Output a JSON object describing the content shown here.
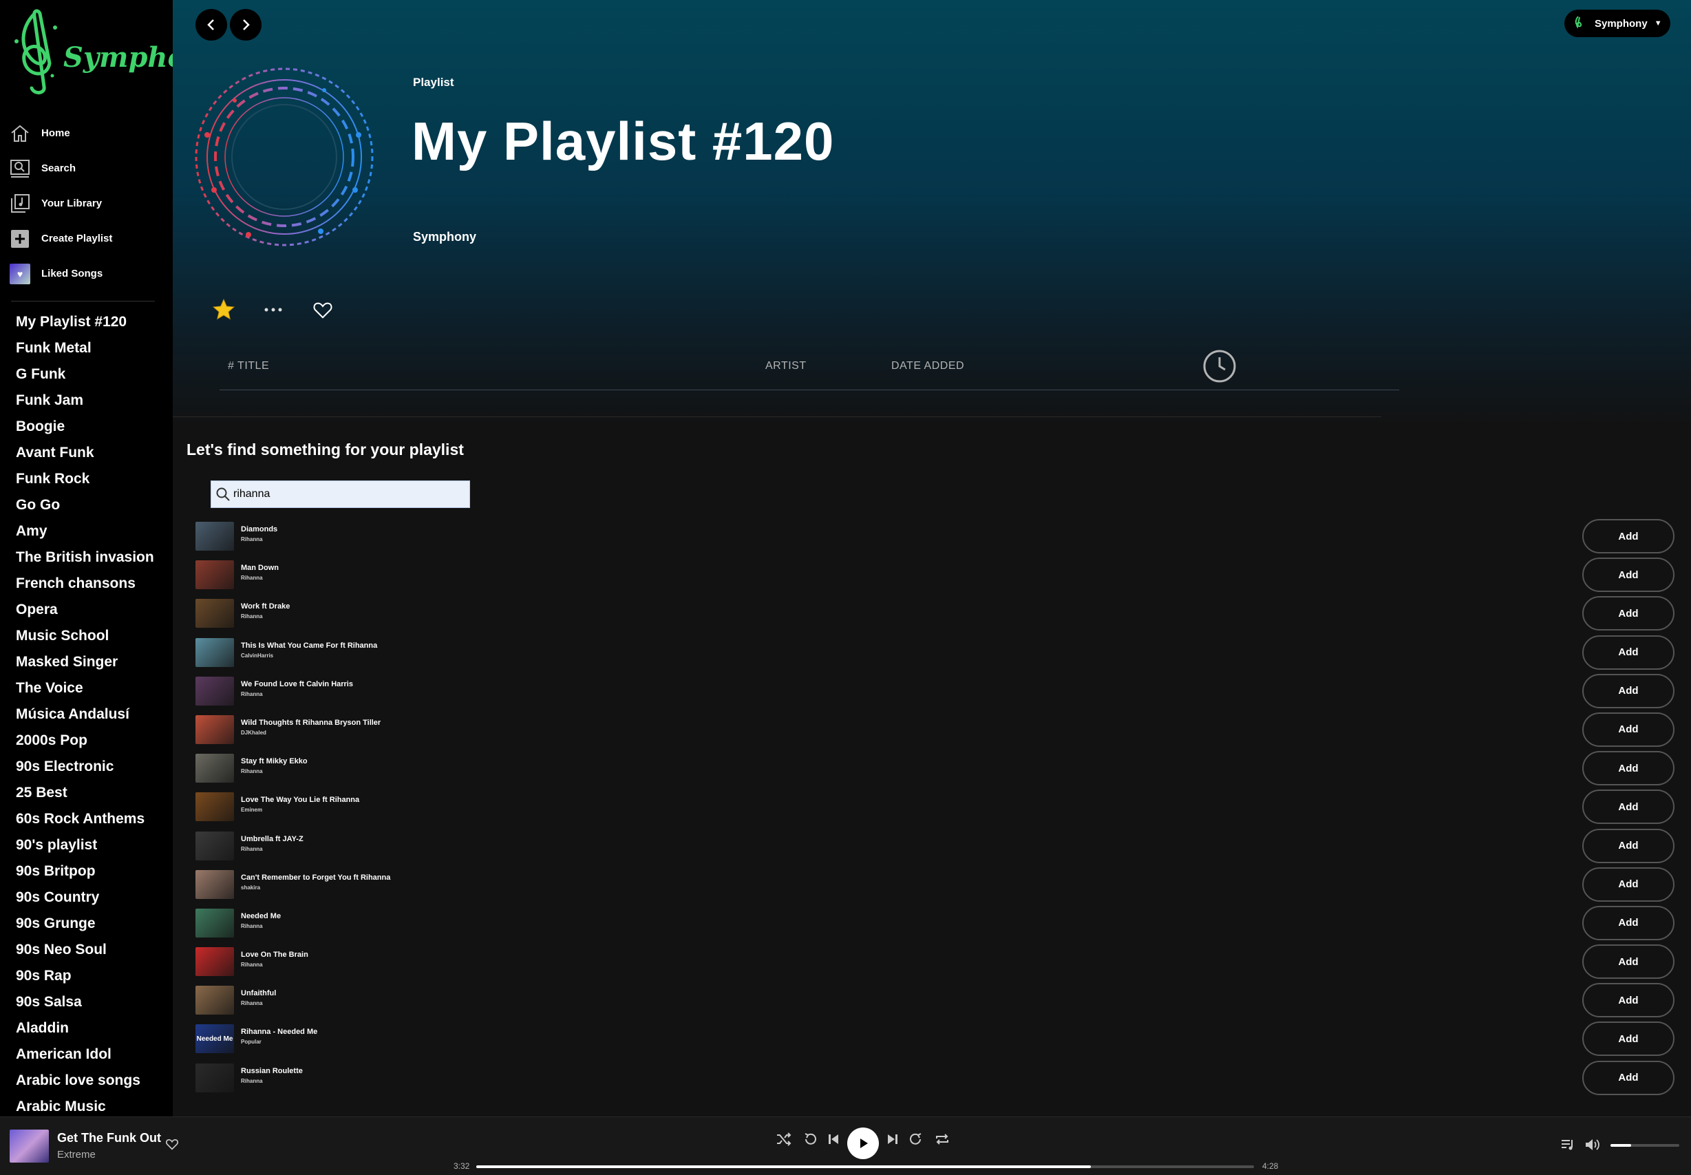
{
  "brand": {
    "name": "Symphony",
    "accent": "#3fd36b"
  },
  "nav": [
    {
      "label": "Home",
      "icon": "home-icon"
    },
    {
      "label": "Search",
      "icon": "search-icon"
    },
    {
      "label": "Your Library",
      "icon": "library-icon"
    },
    {
      "label": "Create Playlist",
      "icon": "plus-icon"
    },
    {
      "label": "Liked Songs",
      "icon": "heart-icon"
    }
  ],
  "playlists": [
    "My Playlist #120",
    "Funk Metal",
    "G Funk",
    "Funk Jam",
    "Boogie",
    "Avant Funk",
    "Funk Rock",
    "Go Go",
    "Amy",
    "The British invasion",
    "French chansons",
    "Opera",
    "Music School",
    "Masked Singer",
    "The Voice",
    "Música Andalusí",
    "2000s Pop",
    "90s Electronic",
    "25 Best",
    "60s Rock Anthems",
    "90's playlist",
    "90s Britpop",
    "90s Country",
    "90s Grunge",
    "90s Neo Soul",
    "90s Rap",
    "90s Salsa",
    "Aladdin",
    "American Idol",
    "Arabic love songs",
    "Arabic Music"
  ],
  "user": {
    "name": "Symphony"
  },
  "header": {
    "type": "Playlist",
    "title": "My Playlist #120",
    "owner": "Symphony"
  },
  "table": {
    "col_title": "# TITLE",
    "col_artist": "ARTIST",
    "col_date": "DATE ADDED"
  },
  "finder": {
    "title": "Let's find something for your playlist",
    "query": "rihanna",
    "add_label": "Add"
  },
  "results": [
    {
      "title": "Diamonds",
      "artist": "Rihanna",
      "thumb": "#4a5d6e"
    },
    {
      "title": "Man Down",
      "artist": "Rihanna",
      "thumb": "#8a3b2e"
    },
    {
      "title": "Work ft Drake",
      "artist": "Rihanna",
      "thumb": "#6a4a2a"
    },
    {
      "title": "This Is What You Came For ft Rihanna",
      "artist": "CalvinHarris",
      "thumb": "#5a8fa0"
    },
    {
      "title": "We Found Love ft Calvin Harris",
      "artist": "Rihanna",
      "thumb": "#5b3a5e"
    },
    {
      "title": "Wild Thoughts ft Rihanna Bryson Tiller",
      "artist": "DJKhaled",
      "thumb": "#c0503a"
    },
    {
      "title": "Stay ft Mikky Ekko",
      "artist": "Rihanna",
      "thumb": "#6b6b62"
    },
    {
      "title": "Love The Way You Lie ft Rihanna",
      "artist": "Eminem",
      "thumb": "#7a4a1e"
    },
    {
      "title": "Umbrella ft JAY-Z",
      "artist": "Rihanna",
      "thumb": "#3a3a3a"
    },
    {
      "title": "Can't Remember to Forget You ft Rihanna",
      "artist": "shakira",
      "thumb": "#9a7a6a"
    },
    {
      "title": "Needed Me",
      "artist": "Rihanna",
      "thumb": "#3e7a5e"
    },
    {
      "title": "Love On The Brain",
      "artist": "Rihanna",
      "thumb": "#c92a2a"
    },
    {
      "title": "Unfaithful",
      "artist": "Rihanna",
      "thumb": "#8a6a4a"
    },
    {
      "title": "Rihanna - Needed Me",
      "artist": "Popular",
      "thumb": "#1f3a8a",
      "thumb_text": "Needed Me"
    },
    {
      "title": "Russian Roulette",
      "artist": "Rihanna",
      "thumb": "#2a2a2a"
    }
  ],
  "player": {
    "title": "Get The Funk Out",
    "artist": "Extreme",
    "elapsed": "3:32",
    "duration": "4:28",
    "progress": 0.79,
    "volume": 0.3
  }
}
